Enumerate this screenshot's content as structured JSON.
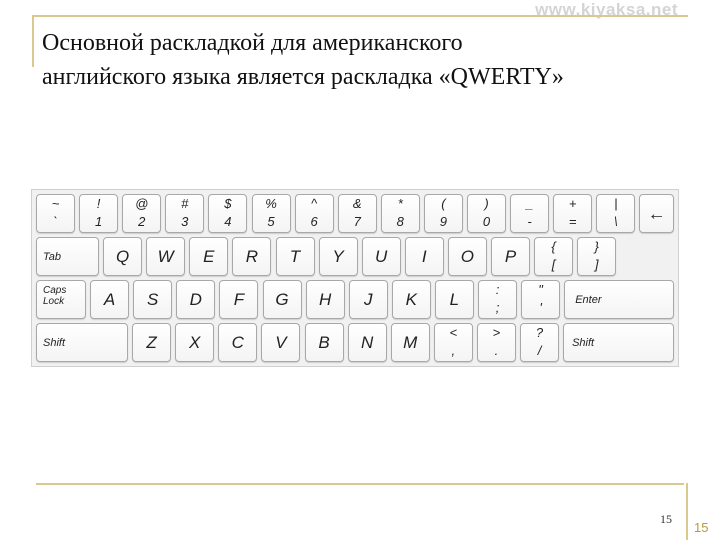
{
  "watermark": "www.kiyaksa.net",
  "title": {
    "line1": "Основной раскладкой для американского",
    "line2": "английского языка является раскладка «QWERTY»"
  },
  "keyboard": {
    "row1": [
      {
        "top": "~",
        "bottom": "`"
      },
      {
        "top": "!",
        "bottom": "1"
      },
      {
        "top": "@",
        "bottom": "2"
      },
      {
        "top": "#",
        "bottom": "3"
      },
      {
        "top": "$",
        "bottom": "4"
      },
      {
        "top": "%",
        "bottom": "5"
      },
      {
        "top": "^",
        "bottom": "6"
      },
      {
        "top": "&",
        "bottom": "7"
      },
      {
        "top": "*",
        "bottom": "8"
      },
      {
        "top": "(",
        "bottom": "9"
      },
      {
        "top": ")",
        "bottom": "0"
      },
      {
        "top": "_",
        "bottom": "-"
      },
      {
        "top": "+",
        "bottom": "="
      },
      {
        "top": "|",
        "bottom": "\\"
      },
      {
        "label": "←"
      }
    ],
    "row2": [
      {
        "label": "Tab"
      },
      {
        "label": "Q"
      },
      {
        "label": "W"
      },
      {
        "label": "E"
      },
      {
        "label": "R"
      },
      {
        "label": "T"
      },
      {
        "label": "Y"
      },
      {
        "label": "U"
      },
      {
        "label": "I"
      },
      {
        "label": "O"
      },
      {
        "label": "P"
      },
      {
        "top": "{",
        "bottom": "["
      },
      {
        "top": "}",
        "bottom": "]"
      }
    ],
    "row3": [
      {
        "label": "Caps Lock"
      },
      {
        "label": "A"
      },
      {
        "label": "S"
      },
      {
        "label": "D"
      },
      {
        "label": "F"
      },
      {
        "label": "G"
      },
      {
        "label": "H"
      },
      {
        "label": "J"
      },
      {
        "label": "K"
      },
      {
        "label": "L"
      },
      {
        "top": ":",
        "bottom": ";"
      },
      {
        "top": "\"",
        "bottom": "'"
      },
      {
        "label": "Enter"
      }
    ],
    "row4": [
      {
        "label": "Shift"
      },
      {
        "label": "Z"
      },
      {
        "label": "X"
      },
      {
        "label": "C"
      },
      {
        "label": "V"
      },
      {
        "label": "B"
      },
      {
        "label": "N"
      },
      {
        "label": "M"
      },
      {
        "top": "<",
        "bottom": ","
      },
      {
        "top": ">",
        "bottom": "."
      },
      {
        "top": "?",
        "bottom": "/"
      },
      {
        "label": "Shift"
      }
    ]
  },
  "footer": {
    "page_small": "15",
    "page_number": "15"
  }
}
